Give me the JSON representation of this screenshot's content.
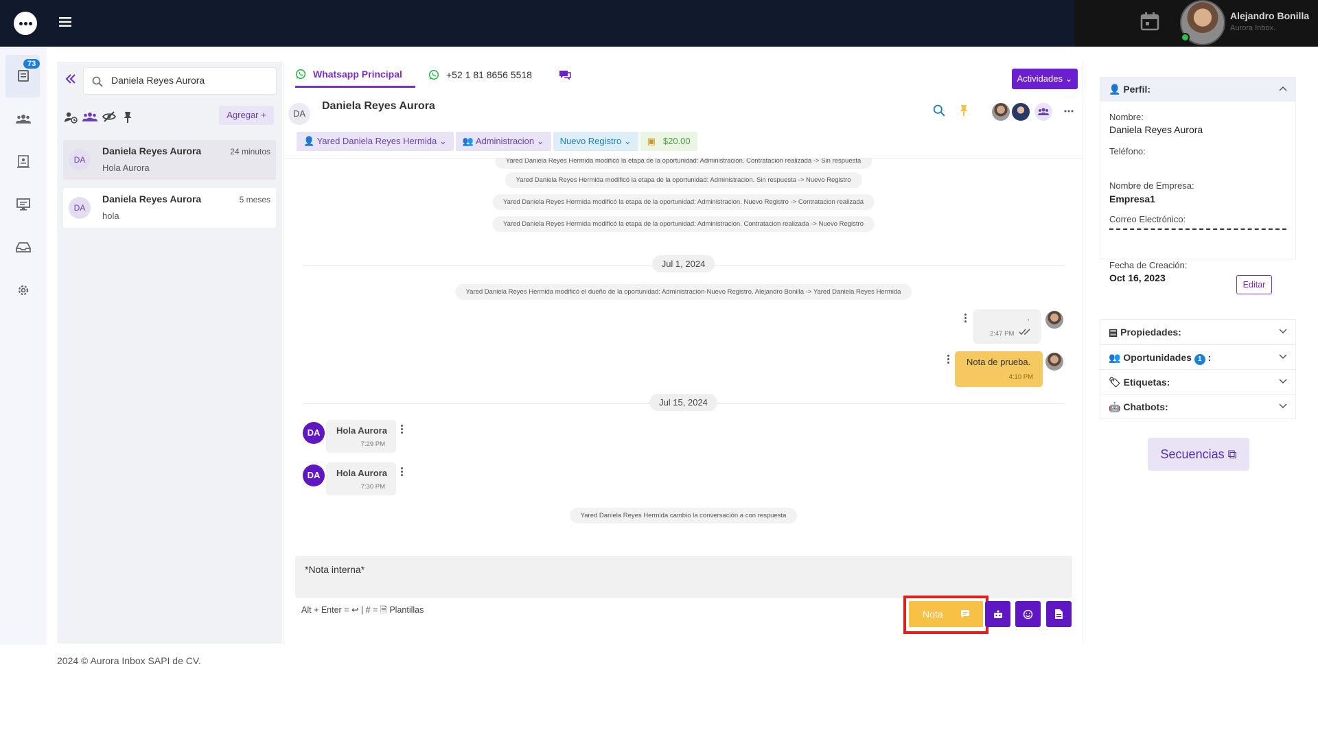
{
  "topbar": {
    "user_name": "Alejandro Bonilla",
    "user_sub": "Aurora Inbox."
  },
  "rail": {
    "badge": "73"
  },
  "list": {
    "search_value": "Daniela Reyes Aurora",
    "add_label": "Agregar +",
    "conversations": [
      {
        "initials": "DA",
        "name": "Daniela Reyes Aurora",
        "message": "Hola Aurora",
        "time": "24 minutos"
      },
      {
        "initials": "DA",
        "name": "Daniela Reyes Aurora",
        "message": "hola",
        "time": "5 meses"
      }
    ]
  },
  "chat": {
    "tabs": [
      {
        "label": "Whatsapp Principal"
      },
      {
        "label": "+52 1 81 8656 5518"
      }
    ],
    "activities_label": "Actividades",
    "contact_initials": "DA",
    "contact_name": "Daniela Reyes Aurora",
    "tags": {
      "owner": "Yared Daniela Reyes Hermida",
      "team": "Administracion",
      "stage": "Nuevo Registro",
      "amount": "$20.00"
    },
    "messages": {
      "sys0": "Yared Daniela Reyes Hermida modificó la etapa de la oportunidad: Administracion. Contratacion realizada -> Sin respuesta",
      "sys1": "Yared Daniela Reyes Hermida modificó la etapa de la oportunidad: Administracion. Sin respuesta -> Nuevo Registro",
      "sys2": "Yared Daniela Reyes Hermida modificó la etapa de la oportunidad: Administracion. Nuevo Registro -> Contratacion realizada",
      "sys3": "Yared Daniela Reyes Hermida modificó la etapa de la oportunidad: Administracion. Contratacion realizada -> Nuevo Registro",
      "date1": "Jul 1, 2024",
      "sys4": "Yared Daniela Reyes Hermida modificó el dueño de la oportunidad: Administracion-Nuevo Registro. Alejandro Bonilla -> Yared Daniela Reyes Hermida",
      "out1_text": ".",
      "out1_time": "2:47 PM",
      "note_text": "Nota de prueba.",
      "note_time": "4:10 PM",
      "date2": "Jul 15, 2024",
      "in1_text": "Hola Aurora",
      "in1_time": "7:29 PM",
      "in2_text": "Hola Aurora",
      "in2_time": "7:30 PM",
      "in_initials": "DA",
      "sys5": "Yared Daniela Reyes Hermida cambio la conversación a con respuesta"
    },
    "composer_value": "*Nota interna*",
    "hint": "Alt + Enter = ↩  |  # = 🗎 Plantillas",
    "note_btn": "Nota"
  },
  "profile": {
    "title": "Perfil:",
    "name_label": "Nombre:",
    "name_value": "Daniela Reyes Aurora",
    "phone_label": "Teléfono:",
    "company_label": "Nombre de Empresa:",
    "company_value": "Empresa1",
    "email_label": "Correo Electrónico:",
    "created_label": "Fecha de Creación:",
    "created_value": "Oct 16, 2023",
    "edit_label": "Editar",
    "sections": [
      {
        "label": "Propiedades:"
      },
      {
        "label": "Oportunidades",
        "badge": "1",
        "suffix": ":"
      },
      {
        "label": "Etiquetas:"
      },
      {
        "label": "Chatbots:"
      }
    ],
    "sequences_label": "Secuencias"
  },
  "footer": "2024 © Aurora Inbox SAPI de CV.",
  "colors": {
    "topbar": "#111a2c",
    "accent": "#6c1fd1",
    "note": "#f6c145",
    "highlight": "#e0201a"
  }
}
